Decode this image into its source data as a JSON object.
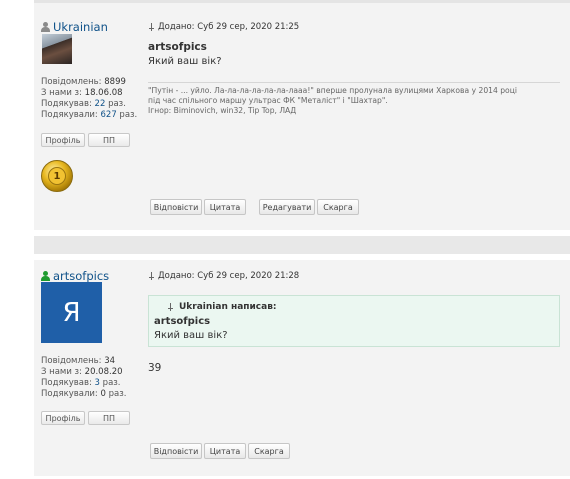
{
  "post1": {
    "author": "Ukrainian",
    "post_info": "Додано: Суб 29 сер, 2020 21:25",
    "title": "artsofpics",
    "text": "Який ваш вік?",
    "stats": {
      "posts_label": "Повідомлень:",
      "posts_value": "8899",
      "joined_label": "З нами з:",
      "joined_value": "18.06.08",
      "thanked_label": "Подякував:",
      "thanked_value": "22",
      "thanked_suffix": " раз.",
      "was_thanked_label": "Подякували:",
      "was_thanked_value": "627",
      "was_thanked_suffix": " раз."
    },
    "medal_text": "1",
    "signature_line1": "\"Путін - ... уйло. Ла-ла-ла-ла-ла-ла-лааа!\" вперше пролунала вулицями Харкова у 2014 році",
    "signature_line2": "під час спільного маршу ультрас ФК \"Металіст\" і \"Шахтар\".",
    "signature_line3": "Ігнор: Biminovich, win32, Tip Top, ЛАД",
    "profile_btn": "Профіль",
    "pm_btn": "ПП",
    "reply_btn": "Відповісти",
    "quote_btn": "Цитата",
    "edit_btn": "Редагувати",
    "report_btn": "Скарга"
  },
  "post2": {
    "author": "artsofpics",
    "avatar_letter": "Я",
    "post_info": "Додано: Суб 29 сер, 2020 21:28",
    "quote": {
      "head": "Ukrainian написав:",
      "title": "artsofpics",
      "text": "Який ваш вік?"
    },
    "answer": "39",
    "stats": {
      "posts_label": "Повідомлень:",
      "posts_value": "34",
      "joined_label": "З нами з:",
      "joined_value": "20.08.20",
      "thanked_label": "Подякував:",
      "thanked_value": "3",
      "thanked_suffix": " раз.",
      "was_thanked_label": "Подякували:",
      "was_thanked_value": "0",
      "was_thanked_suffix": " раз."
    },
    "profile_btn": "Профіль",
    "pm_btn": "ПП",
    "reply_btn": "Відповісти",
    "quote_btn": "Цитата",
    "report_btn": "Скарга"
  },
  "colors": {
    "link": "#105289",
    "online": "#1f9b2f",
    "avatar_bg": "#1f5fa8",
    "quote_bg": "#ebf7f1",
    "post_bg": "#f3f3f3"
  }
}
